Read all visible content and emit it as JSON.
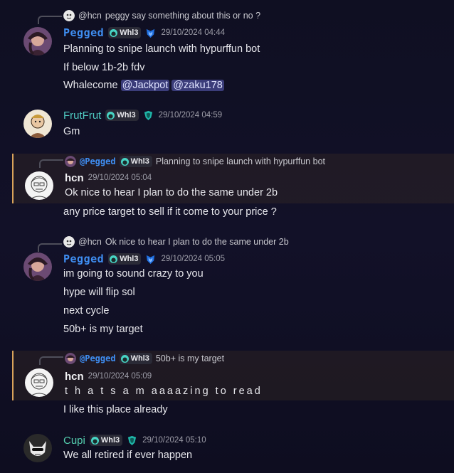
{
  "colors": {
    "accent_mention": "#d9a35a",
    "pegged_name": "#3f8ef2",
    "role_tag_bg": "#2a2a36",
    "mention_pill": "#3b3d7a"
  },
  "messages": [
    {
      "reply": {
        "author": "@hcn",
        "text": "peggy say something about this or no ?"
      },
      "author": "Pegged",
      "tag": "Whl3",
      "time": "29/10/2024 04:44",
      "lines": [
        "Planning to snipe launch with hypurffun bot",
        "If below 1b-2b fdv"
      ],
      "mention_line": {
        "prefix": "Whalecome",
        "mentions": [
          "@Jackpot",
          "@zaku178"
        ]
      }
    },
    {
      "author": "FrutFrut",
      "tag": "Whl3",
      "time": "29/10/2024 04:59",
      "lines": [
        "Gm"
      ]
    },
    {
      "reply": {
        "author": "@Pegged",
        "tag": "Whl3",
        "text": "Planning to snipe launch with hypurffun bot"
      },
      "author": "hcn",
      "time": "29/10/2024 05:04",
      "lines": [
        "Ok nice to hear I plan to do the same under 2b",
        "any price target to sell if it come to your price ?"
      ]
    },
    {
      "reply": {
        "author": "@hcn",
        "text": "Ok nice to hear I plan to do the same under 2b"
      },
      "author": "Pegged",
      "tag": "Whl3",
      "time": "29/10/2024 05:05",
      "lines": [
        "im going to sound crazy to you",
        "hype will flip sol",
        "next cycle",
        "50b+ is my target"
      ]
    },
    {
      "reply": {
        "author": "@Pegged",
        "tag": "Whl3",
        "text": "50b+ is my target"
      },
      "author": "hcn",
      "time": "29/10/2024 05:09",
      "lines": [
        "t h a t s   a m aaaazing to read",
        "I like this place already"
      ]
    },
    {
      "author": "Cupi",
      "tag": "Whl3",
      "time": "29/10/2024 05:10",
      "lines": [
        "We all retired if ever happen"
      ]
    }
  ]
}
